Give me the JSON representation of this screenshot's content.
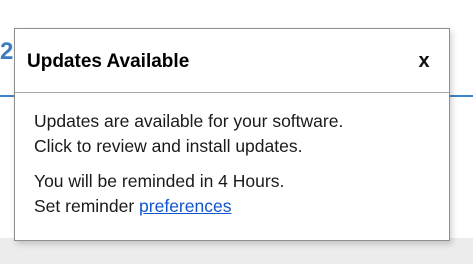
{
  "background": {
    "partial_number": "2"
  },
  "popup": {
    "title": "Updates Available",
    "close_symbol": "x",
    "message_line1": "Updates are available for your software.",
    "message_line2": "Click to review and install updates.",
    "reminder_line": "You will be reminded in 4 Hours.",
    "set_reminder_prefix": "Set reminder ",
    "preferences_link": "preferences"
  },
  "colors": {
    "accent_line": "#3b86c8",
    "link": "#1155cc"
  }
}
